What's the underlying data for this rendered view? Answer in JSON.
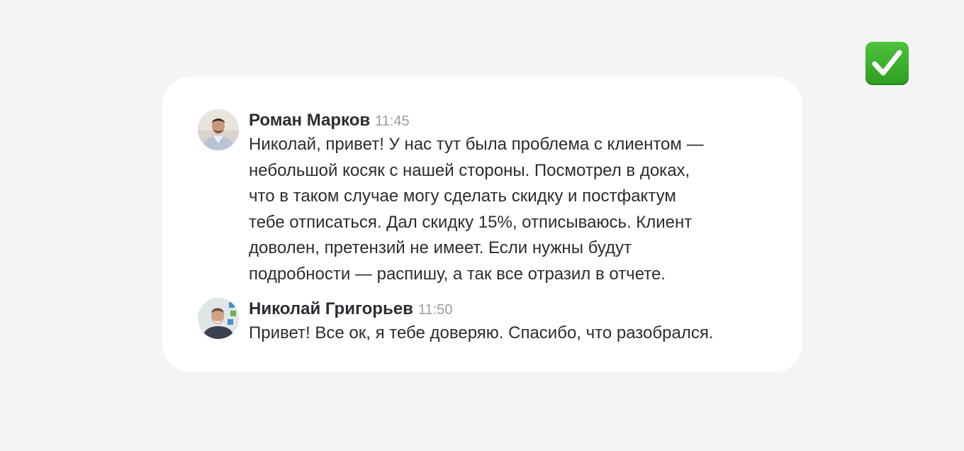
{
  "status_icon": {
    "name": "check-mark-icon",
    "color": "#3aa82c"
  },
  "messages": [
    {
      "author": "Роман Марков",
      "time": "11:45",
      "avatar_icon": "avatar-roman",
      "lines": [
        "Николай, привет! У нас тут была проблема с клиентом —",
        "небольшой косяк с нашей стороны. Посмотрел в доках,",
        "что в таком случае могу сделать скидку и постфактум",
        "тебе отписаться. Дал скидку 15%, отписываюсь. Клиент",
        "доволен, претензий не имеет. Если нужны будут",
        "подробности — распишу, а так все отразил в отчете."
      ]
    },
    {
      "author": "Николай Григорьев",
      "time": "11:50",
      "avatar_icon": "avatar-nikolai",
      "lines": [
        "Привет! Все ок, я тебе доверяю. Спасибо, что разобрался."
      ]
    }
  ]
}
